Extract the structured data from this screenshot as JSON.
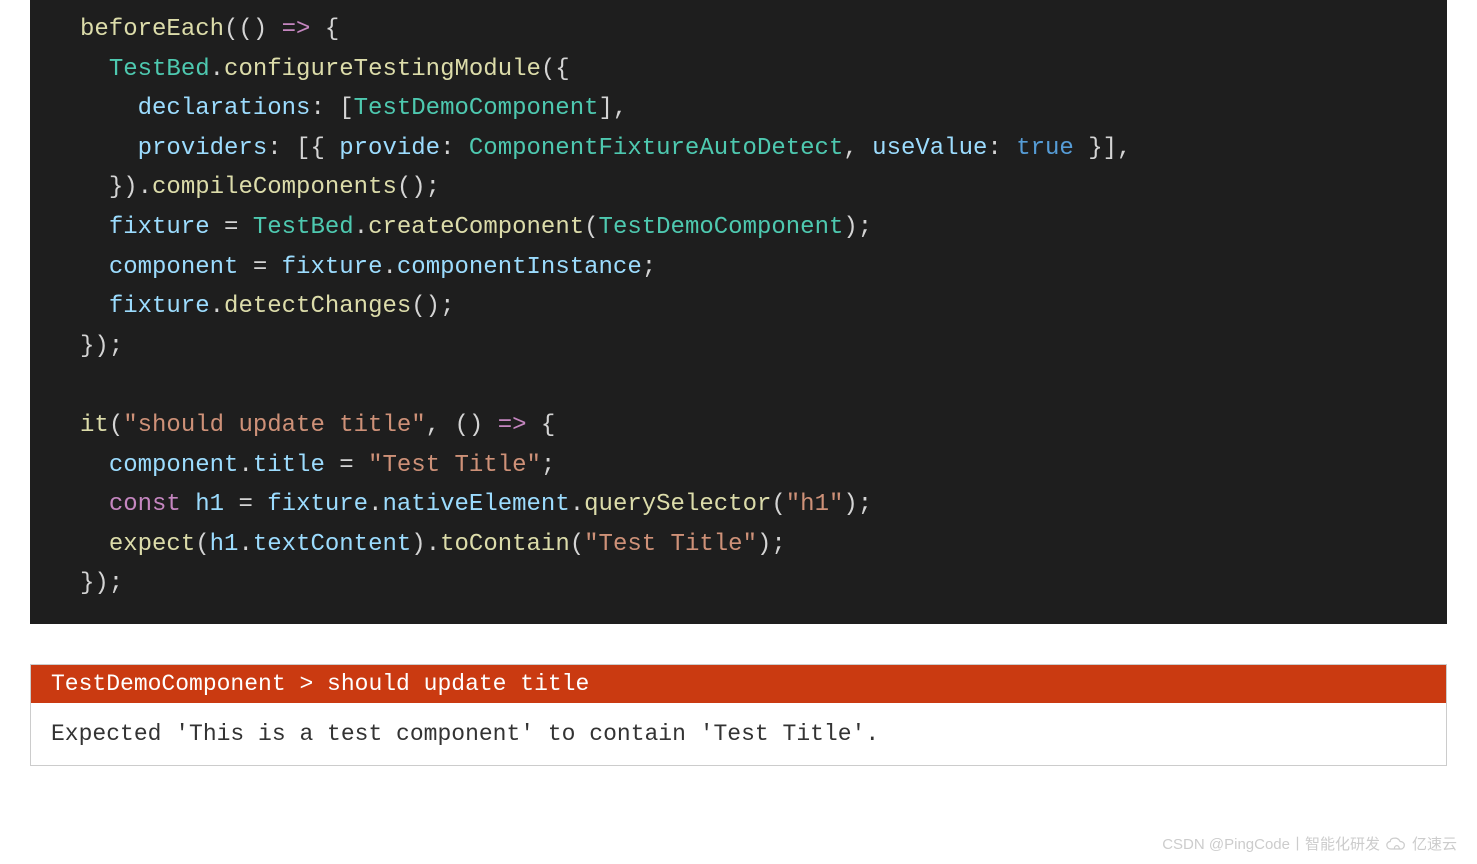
{
  "code": {
    "lines": [
      {
        "indent": 0,
        "tokens": [
          [
            "func",
            "beforeEach"
          ],
          [
            "punct",
            "(() "
          ],
          [
            "keyword",
            "=>"
          ],
          [
            "punct",
            " {"
          ]
        ]
      },
      {
        "indent": 1,
        "tokens": [
          [
            "class",
            "TestBed"
          ],
          [
            "punct",
            "."
          ],
          [
            "func",
            "configureTestingModule"
          ],
          [
            "punct",
            "({"
          ]
        ]
      },
      {
        "indent": 2,
        "tokens": [
          [
            "prop",
            "declarations"
          ],
          [
            "punct",
            ": ["
          ],
          [
            "class",
            "TestDemoComponent"
          ],
          [
            "punct",
            "],"
          ]
        ]
      },
      {
        "indent": 2,
        "tokens": [
          [
            "prop",
            "providers"
          ],
          [
            "punct",
            ": [{ "
          ],
          [
            "prop",
            "provide"
          ],
          [
            "punct",
            ": "
          ],
          [
            "class",
            "ComponentFixtureAutoDetect"
          ],
          [
            "punct",
            ", "
          ],
          [
            "prop",
            "useValue"
          ],
          [
            "punct",
            ": "
          ],
          [
            "const",
            "true"
          ],
          [
            "punct",
            " }],"
          ]
        ]
      },
      {
        "indent": 1,
        "tokens": [
          [
            "punct",
            "})."
          ],
          [
            "func",
            "compileComponents"
          ],
          [
            "punct",
            "();"
          ]
        ]
      },
      {
        "indent": 1,
        "tokens": [
          [
            "ident",
            "fixture"
          ],
          [
            "punct",
            " = "
          ],
          [
            "class",
            "TestBed"
          ],
          [
            "punct",
            "."
          ],
          [
            "func",
            "createComponent"
          ],
          [
            "punct",
            "("
          ],
          [
            "class",
            "TestDemoComponent"
          ],
          [
            "punct",
            ");"
          ]
        ]
      },
      {
        "indent": 1,
        "tokens": [
          [
            "ident",
            "component"
          ],
          [
            "punct",
            " = "
          ],
          [
            "ident",
            "fixture"
          ],
          [
            "punct",
            "."
          ],
          [
            "ident",
            "componentInstance"
          ],
          [
            "punct",
            ";"
          ]
        ]
      },
      {
        "indent": 1,
        "tokens": [
          [
            "ident",
            "fixture"
          ],
          [
            "punct",
            "."
          ],
          [
            "func",
            "detectChanges"
          ],
          [
            "punct",
            "();"
          ]
        ]
      },
      {
        "indent": 0,
        "tokens": [
          [
            "punct",
            "});"
          ]
        ]
      },
      {
        "indent": 0,
        "tokens": []
      },
      {
        "indent": 0,
        "tokens": [
          [
            "func",
            "it"
          ],
          [
            "punct",
            "("
          ],
          [
            "string",
            "\"should update title\""
          ],
          [
            "punct",
            ", () "
          ],
          [
            "keyword",
            "=>"
          ],
          [
            "punct",
            " {"
          ]
        ]
      },
      {
        "indent": 1,
        "tokens": [
          [
            "ident",
            "component"
          ],
          [
            "punct",
            "."
          ],
          [
            "ident",
            "title"
          ],
          [
            "punct",
            " = "
          ],
          [
            "string",
            "\"Test Title\""
          ],
          [
            "punct",
            ";"
          ]
        ]
      },
      {
        "indent": 1,
        "tokens": [
          [
            "keyword",
            "const"
          ],
          [
            "punct",
            " "
          ],
          [
            "ident",
            "h1"
          ],
          [
            "punct",
            " = "
          ],
          [
            "ident",
            "fixture"
          ],
          [
            "punct",
            "."
          ],
          [
            "ident",
            "nativeElement"
          ],
          [
            "punct",
            "."
          ],
          [
            "func",
            "querySelector"
          ],
          [
            "punct",
            "("
          ],
          [
            "string",
            "\"h1\""
          ],
          [
            "punct",
            ");"
          ]
        ]
      },
      {
        "indent": 1,
        "tokens": [
          [
            "func",
            "expect"
          ],
          [
            "punct",
            "("
          ],
          [
            "ident",
            "h1"
          ],
          [
            "punct",
            "."
          ],
          [
            "ident",
            "textContent"
          ],
          [
            "punct",
            ")."
          ],
          [
            "func",
            "toContain"
          ],
          [
            "punct",
            "("
          ],
          [
            "string",
            "\"Test Title\""
          ],
          [
            "punct",
            ");"
          ]
        ]
      },
      {
        "indent": 0,
        "tokens": [
          [
            "punct",
            "});"
          ]
        ]
      }
    ]
  },
  "test": {
    "header": "TestDemoComponent > should update title",
    "message": "Expected 'This is a test component' to contain 'Test Title'."
  },
  "watermark": {
    "text": "CSDN @PingCode丨智能化研发",
    "brand": "亿速云"
  }
}
